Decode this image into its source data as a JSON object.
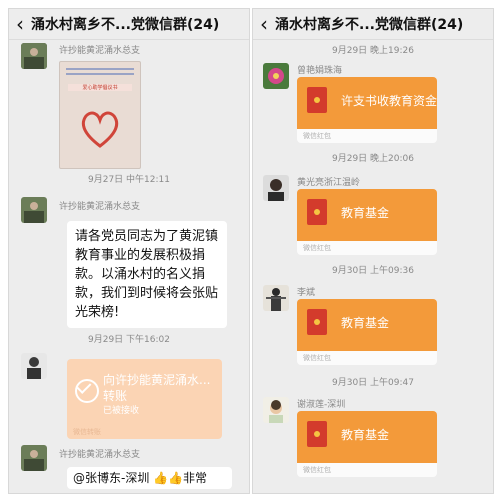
{
  "left": {
    "header": {
      "back_icon": "chevron-left-icon",
      "title": "涌水村离乡不...党微信群(24)"
    },
    "messages": [
      {
        "sender": "许抄能黄泥涌水总支",
        "poster_title": "爱心助学倡议书"
      },
      {
        "timestamp": "9月27日 中午12:11"
      },
      {
        "sender": "许抄能黄泥涌水总支",
        "text": "请各党员同志为了黄泥镇教育事业的发展积极捐款。以涌水村的名义捐款，我们到时候将会张贴光荣榜!"
      },
      {
        "timestamp": "9月29日 下午16:02"
      },
      {
        "transfer": {
          "title": "向许抄能黄泥涌水...",
          "label": "转账",
          "status": "已被接收",
          "footer": "微信转账"
        }
      },
      {
        "sender": "许抄能黄泥涌水总支",
        "text": "@张博东-深圳 👍👍非常"
      }
    ]
  },
  "right": {
    "header": {
      "back_icon": "chevron-left-icon",
      "title": "涌水村离乡不...党微信群(24)"
    },
    "messages": [
      {
        "timestamp": "9月29日 晚上19:26"
      },
      {
        "sender": "曾艳娟珠海",
        "red_packet": {
          "text": "许支书收教育资金",
          "footer": "微信红包"
        }
      },
      {
        "timestamp": "9月29日 晚上20:06"
      },
      {
        "sender": "黄光亮浙江温岭",
        "red_packet": {
          "text": "教育基金",
          "footer": "微信红包"
        }
      },
      {
        "timestamp": "9月30日 上午09:36"
      },
      {
        "sender": "李斌",
        "red_packet": {
          "text": "教育基金",
          "footer": "微信红包"
        }
      },
      {
        "timestamp": "9月30日 上午09:47"
      },
      {
        "sender": "谢淑莲-深圳",
        "red_packet": {
          "text": "教育基金",
          "footer": "微信红包"
        }
      }
    ]
  },
  "colors": {
    "red_packet": "#f39a3a",
    "transfer_done": "#fbd4b4",
    "chat_bg": "#ededed"
  }
}
